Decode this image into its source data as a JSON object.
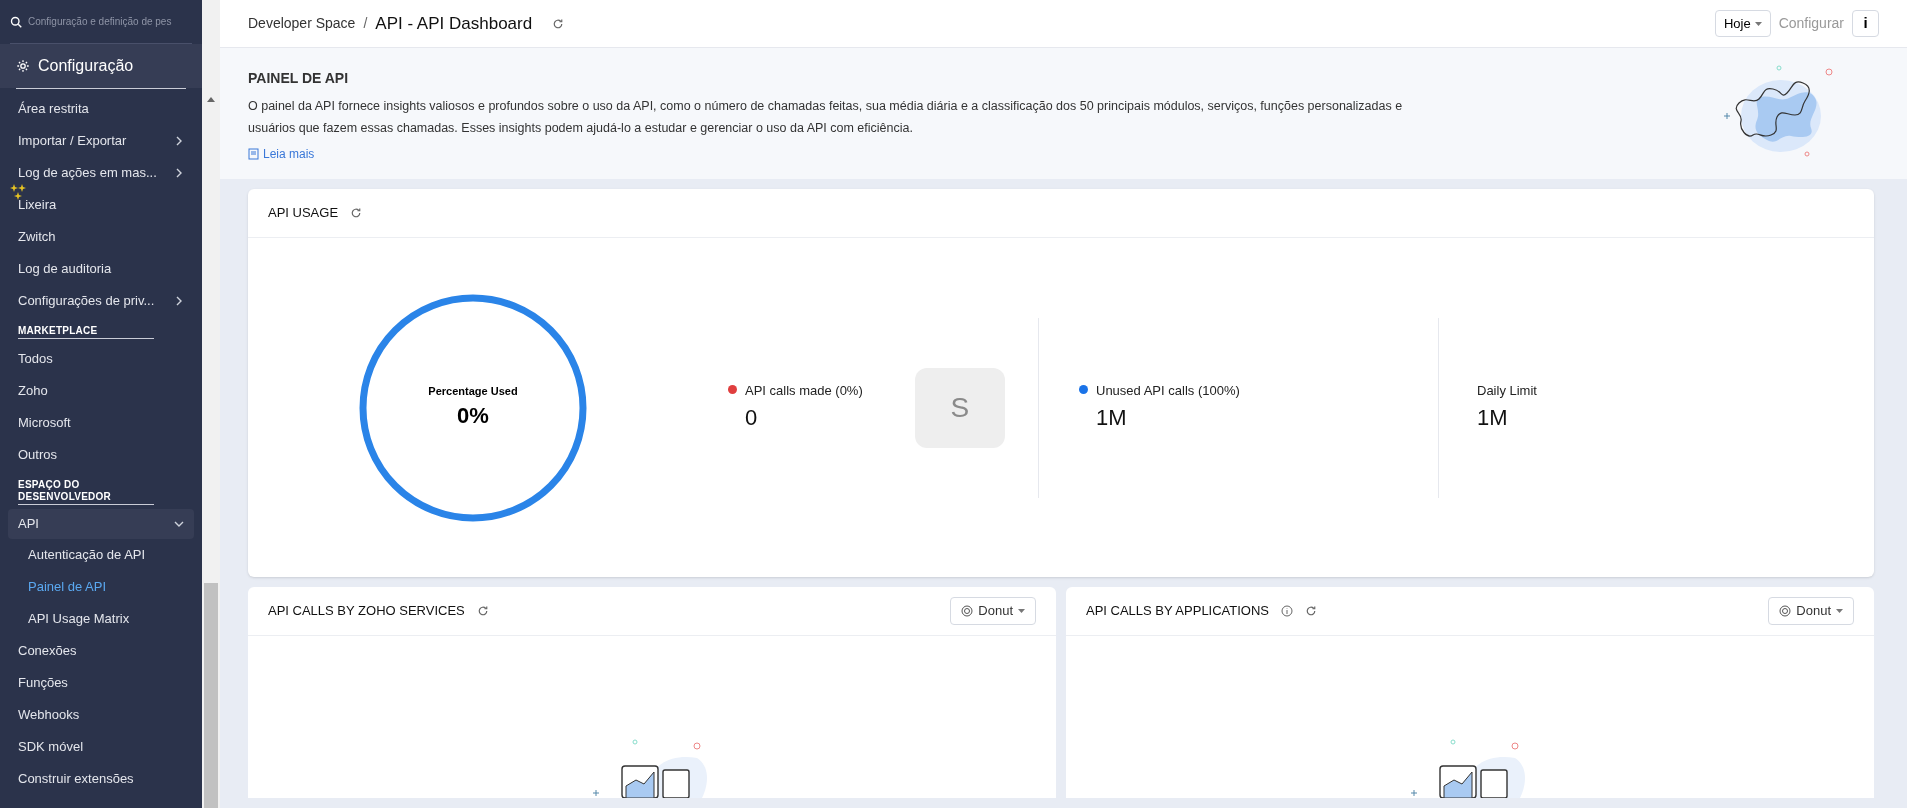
{
  "sidebar": {
    "search": {
      "placeholder": "Configuração e definição de pes"
    },
    "header": "Configuração",
    "items": [
      {
        "kind": "item",
        "label": "Área restrita",
        "submenu": false
      },
      {
        "kind": "item",
        "label": "Importar / Exportar",
        "submenu": true
      },
      {
        "kind": "item",
        "label": "Log de ações em mas...",
        "submenu": true
      },
      {
        "kind": "item",
        "label": "Lixeira",
        "submenu": false
      },
      {
        "kind": "item",
        "label": "Zwitch",
        "submenu": false
      },
      {
        "kind": "item",
        "label": "Log de auditoria",
        "submenu": false
      },
      {
        "kind": "item",
        "label": "Configurações de priv...",
        "submenu": true
      },
      {
        "kind": "section",
        "label": "MARKETPLACE"
      },
      {
        "kind": "item",
        "label": "Todos",
        "submenu": false
      },
      {
        "kind": "item",
        "label": "Zoho",
        "submenu": false
      },
      {
        "kind": "item",
        "label": "Microsoft",
        "submenu": false
      },
      {
        "kind": "item",
        "label": "Outros",
        "submenu": false
      },
      {
        "kind": "section",
        "label": "ESPAÇO DO DESENVOLVEDOR"
      },
      {
        "kind": "group",
        "label": "API",
        "expanded": true,
        "children": [
          {
            "label": "Autenticação de API",
            "selected": false
          },
          {
            "label": "Painel de API",
            "selected": true
          },
          {
            "label": "API Usage Matrix",
            "selected": false
          }
        ]
      },
      {
        "kind": "item",
        "label": "Conexões",
        "submenu": false
      },
      {
        "kind": "item",
        "label": "Funções",
        "submenu": false
      },
      {
        "kind": "item",
        "label": "Webhooks",
        "submenu": false
      },
      {
        "kind": "item",
        "label": "SDK móvel",
        "submenu": false
      },
      {
        "kind": "item",
        "label": "Construir extensões",
        "submenu": false
      }
    ]
  },
  "header": {
    "breadcrumb": "Developer Space",
    "separator": "/",
    "title": "API - API Dashboard",
    "period": "Hoje",
    "info": "i",
    "overlay": "Configurar"
  },
  "banner": {
    "title": "PAINEL DE API",
    "text": "O painel da API fornece insights valiosos e profundos sobre o uso da API, como o número de chamadas feitas, sua média diária e a classificação dos 50 principais módulos, serviços, funções personalizadas e usuários que fazem essas chamadas. Esses insights podem ajudá-lo a estudar e gerenciar o uso da API com eficiência.",
    "link": "Leia mais"
  },
  "usage": {
    "title": "API USAGE",
    "gauge": {
      "label": "Percentage Used",
      "value": "0%",
      "level": 0
    },
    "stats": [
      {
        "kind": "legend",
        "label": "API calls made (0%)",
        "value": "0",
        "color": "#e03e3e",
        "avatar": "S"
      },
      {
        "kind": "legend",
        "label": "Unused API calls (100%)",
        "value": "1M",
        "color": "#1a73e8"
      },
      {
        "kind": "plain",
        "label": "Daily Limit",
        "value": "1M"
      }
    ]
  },
  "panels": [
    {
      "title": "API CALLS BY ZOHO SERVICES",
      "info": false,
      "chart_type": "Donut"
    },
    {
      "title": "API CALLS BY APPLICATIONS",
      "info": true,
      "chart_type": "Donut"
    }
  ]
}
